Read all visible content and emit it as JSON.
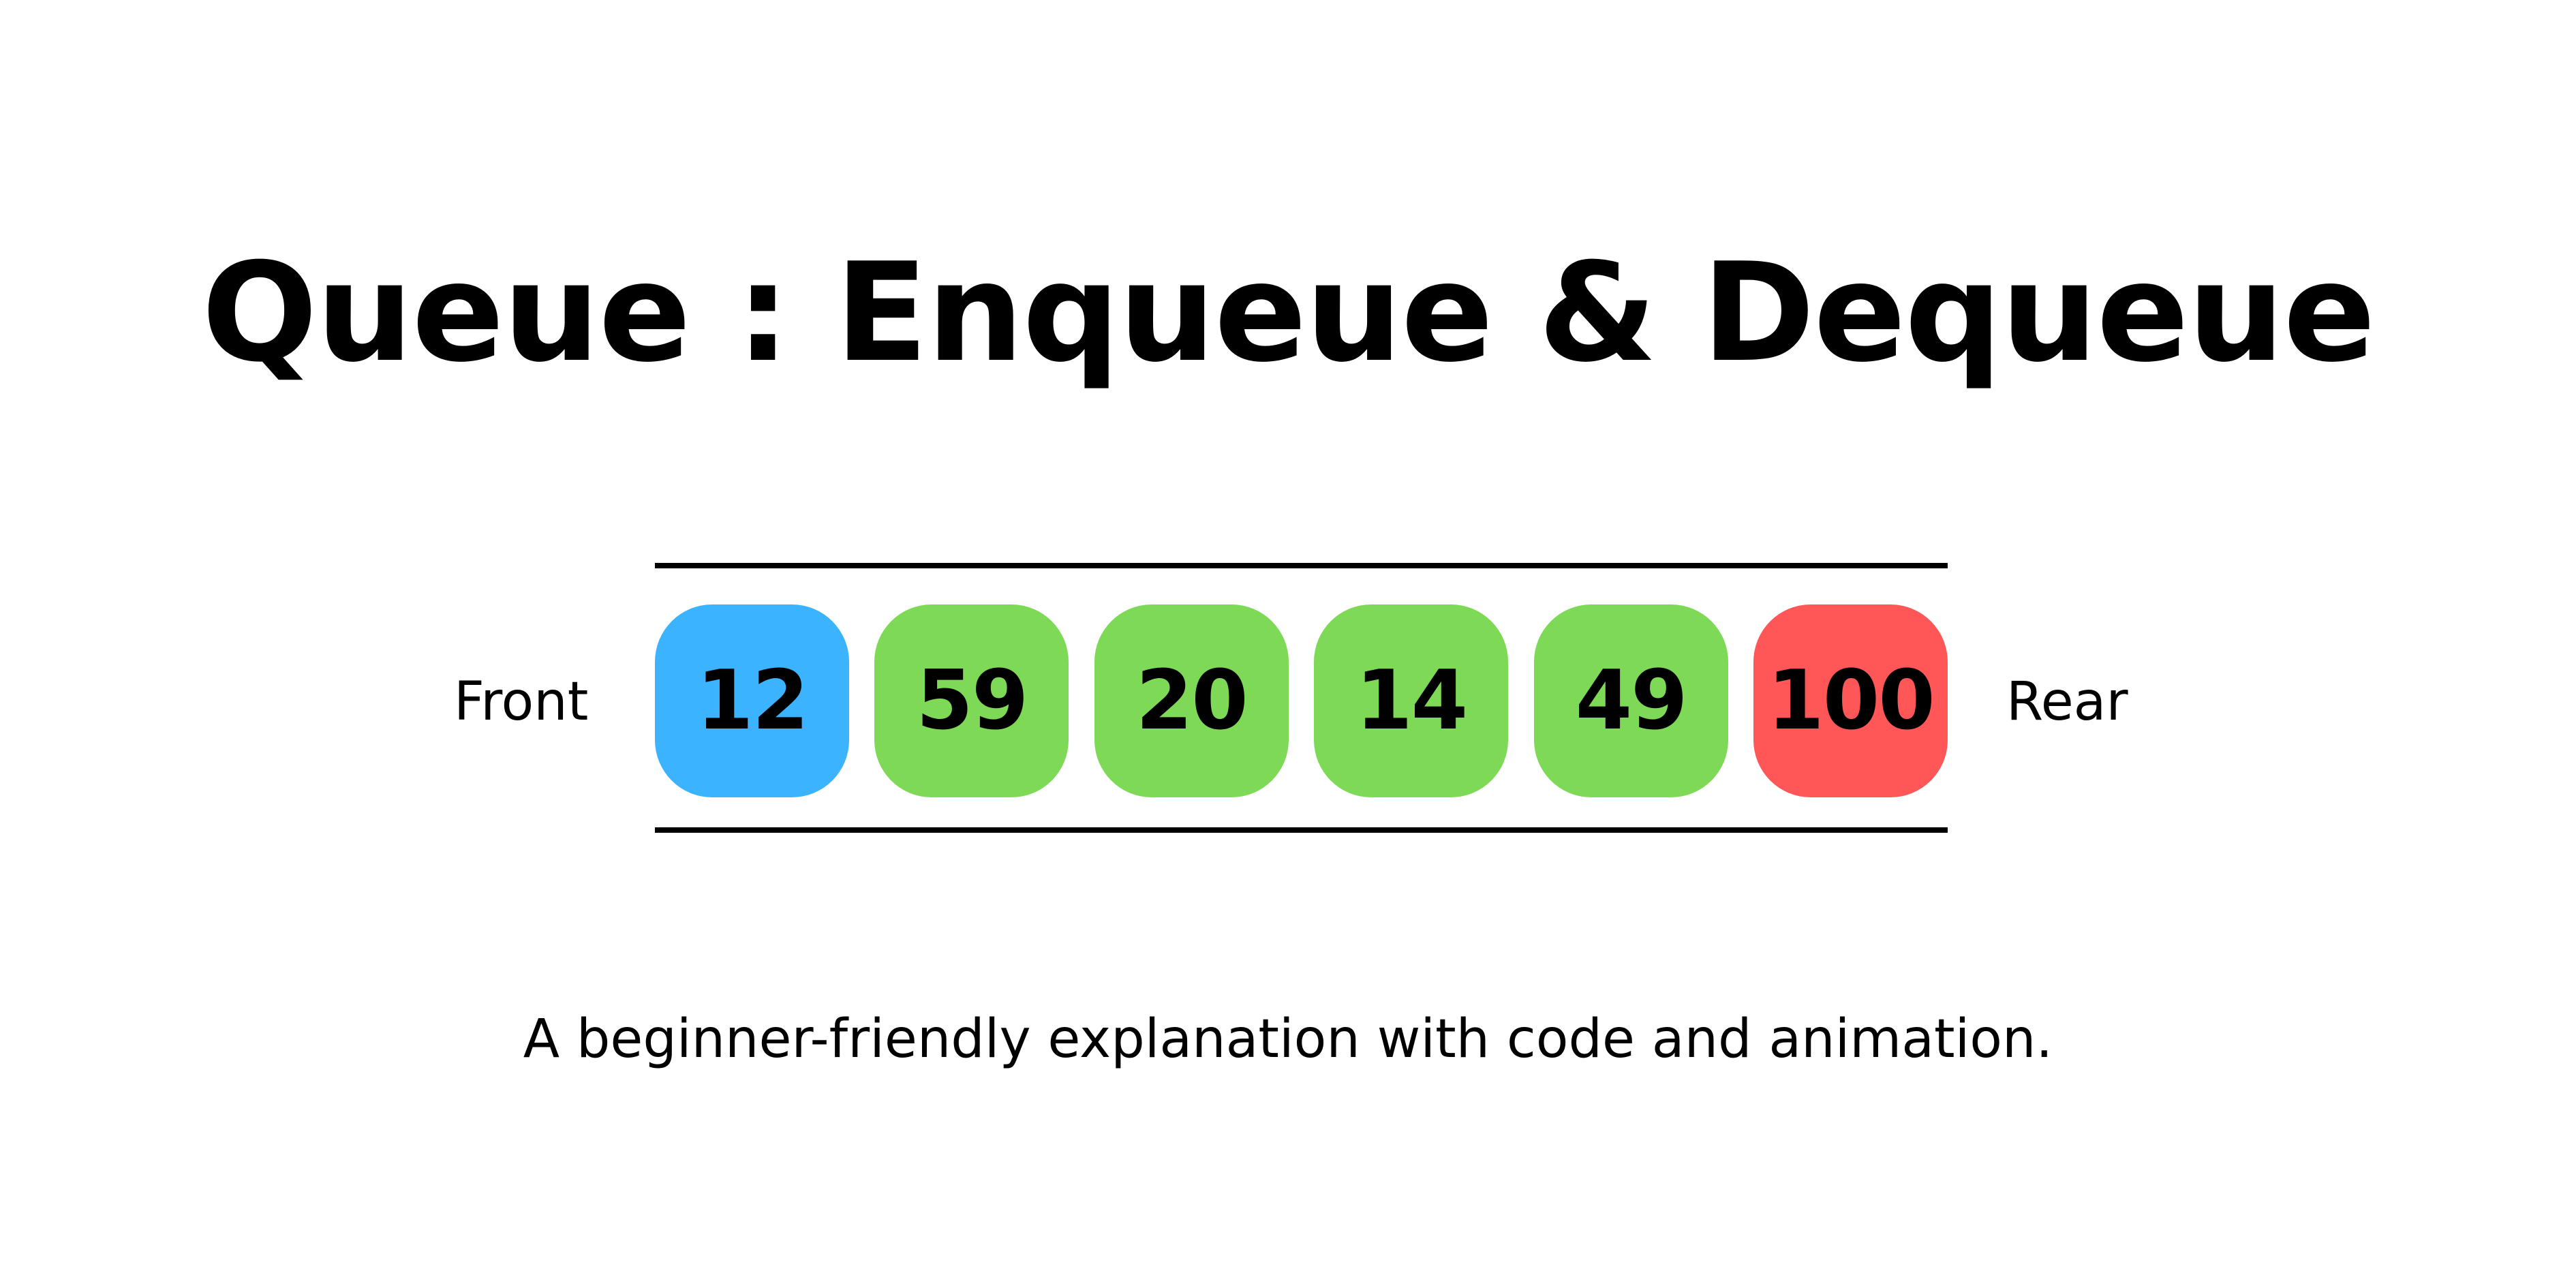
{
  "title": "Queue : Enqueue & Dequeue",
  "subtitle": "A beginner-friendly explanation with code and animation.",
  "labels": {
    "front": "Front",
    "rear": "Rear"
  },
  "colors": {
    "front": "#3BB3FF",
    "middle": "#7ED957",
    "rear": "#FF5757",
    "text": "#000000"
  },
  "queue": {
    "items": [
      {
        "value": "12",
        "role": "front"
      },
      {
        "value": "59",
        "role": "middle"
      },
      {
        "value": "20",
        "role": "middle"
      },
      {
        "value": "14",
        "role": "middle"
      },
      {
        "value": "49",
        "role": "middle"
      },
      {
        "value": "100",
        "role": "rear"
      }
    ]
  }
}
